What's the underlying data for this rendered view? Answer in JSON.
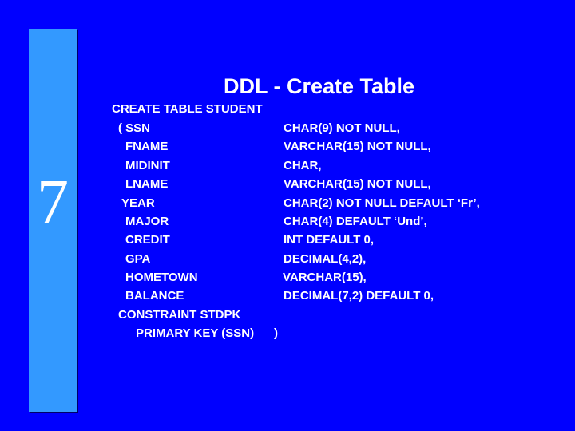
{
  "slide": {
    "number": "7",
    "title": "DDL - Create Table",
    "colors": {
      "background": "#0000ff",
      "side_bar": "#3399ff",
      "text": "#ffffff"
    }
  },
  "statement": {
    "header": "CREATE TABLE STUDENT",
    "columns": [
      {
        "name": "( SSN",
        "definition": "CHAR(9) NOT NULL,"
      },
      {
        "name": "FNAME",
        "definition": "VARCHAR(15) NOT NULL,"
      },
      {
        "name": "MIDINIT",
        "definition": "CHAR,"
      },
      {
        "name": "LNAME",
        "definition": "VARCHAR(15) NOT NULL,"
      },
      {
        "name": "YEAR",
        "definition": "CHAR(2) NOT NULL DEFAULT ‘Fr’,"
      },
      {
        "name": "MAJOR",
        "definition": "CHAR(4) DEFAULT ‘Und’,"
      },
      {
        "name": "CREDIT",
        "definition": "INT DEFAULT 0,"
      },
      {
        "name": "GPA",
        "definition": "DECIMAL(4,2),"
      },
      {
        "name": "HOMETOWN",
        "definition": "VARCHAR(15),"
      },
      {
        "name": "BALANCE",
        "definition": "DECIMAL(7,2) DEFAULT 0,"
      }
    ],
    "constraint": "CONSTRAINT STDPK",
    "primary_key": "PRIMARY KEY (SSN)",
    "closing": ")"
  }
}
